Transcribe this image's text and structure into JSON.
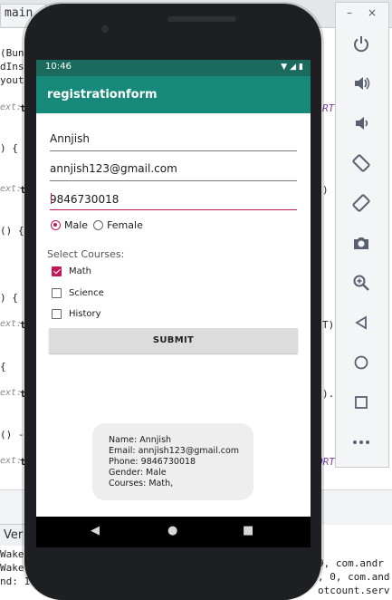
{
  "ide": {
    "tab_label": "main.",
    "code_fragments": {
      "bundle": "(Bun",
      "ldinst": "dIns",
      "yout": "yout",
      "ext1": "ext:",
      "t1": "t",
      "brace1": ") {",
      "ext2": "ext:",
      "t2": "t",
      "brace2": "() {",
      "brace3": ") {",
      "ext3": "ext:",
      "t3": "t",
      "brace4": "{",
      "ext4": "ext:",
      "t4": "t",
      "paren5": "() -",
      "ext5": "ext:",
      "t5": "t"
    },
    "right_fragments": {
      "r1": "RT",
      "r2": ")",
      "r3": "T)",
      "r4": ").",
      "r5": "ORT"
    },
    "bottom_tab": "Ver",
    "log_lines": [
      "Wake",
      "Wake",
      "nd: 1"
    ],
    "log_right": [
      "9, com.andr",
      ", 0, com.and",
      "otcount.serv"
    ]
  },
  "status": {
    "time": "10:46",
    "icons": [
      "wifi-icon",
      "signal-icon",
      "battery-icon"
    ]
  },
  "app_bar": {
    "title": "registrationform"
  },
  "form": {
    "name_value": "Annjish",
    "email_value": "annjish123@gmail.com",
    "phone_value": "9846730018",
    "gender_male": "Male",
    "gender_female": "Female",
    "gender_selected": "Male",
    "courses_label": "Select Courses:",
    "course_math": "Math",
    "course_science": "Science",
    "course_history": "History",
    "math_checked": true,
    "science_checked": false,
    "history_checked": false,
    "submit_label": "SUBMIT"
  },
  "result": {
    "name": "Name: Annjish",
    "email": "Email: annjish123@gmail.com",
    "phone": "Phone: 9846730018",
    "gender": "Gender: Male",
    "courses": "Courses: Math,"
  },
  "nav": {
    "back": "◀",
    "home": "●",
    "recents": "■"
  },
  "emulator_panel": {
    "minimize": "–",
    "close": "×",
    "buttons": [
      {
        "name": "power-icon",
        "glyph": "⏻"
      },
      {
        "name": "volume-up-icon",
        "glyph": "🔊"
      },
      {
        "name": "volume-down-icon",
        "glyph": "🔉"
      },
      {
        "name": "rotate-left-icon",
        "glyph": "⟲"
      },
      {
        "name": "rotate-right-icon",
        "glyph": "⟳"
      },
      {
        "name": "camera-icon",
        "glyph": "📷"
      },
      {
        "name": "zoom-icon",
        "glyph": "🔍"
      },
      {
        "name": "back-icon",
        "glyph": "◁"
      },
      {
        "name": "home-icon",
        "glyph": "○"
      },
      {
        "name": "overview-icon",
        "glyph": "□"
      },
      {
        "name": "more-icon",
        "glyph": "•••"
      }
    ]
  },
  "colors": {
    "accent": "#c2185b",
    "app_bar": "#17897a",
    "status_bar": "#1b6a5e"
  }
}
